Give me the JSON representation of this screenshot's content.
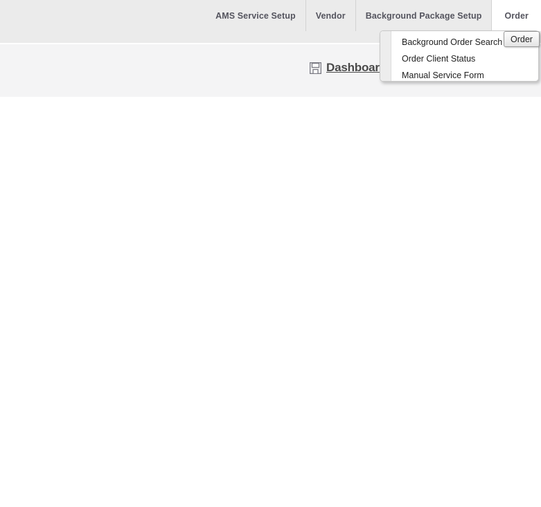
{
  "header": {
    "tabs": [
      {
        "label": "AMS Service Setup",
        "name": "tab-ams-service-setup",
        "active": false
      },
      {
        "label": "Vendor",
        "name": "tab-vendor",
        "active": false
      },
      {
        "label": "Background Package Setup",
        "name": "tab-background-package-setup",
        "active": false
      },
      {
        "label": "Order",
        "name": "tab-order",
        "active": true
      }
    ]
  },
  "sub_header": {
    "dashboard_label": "Dashboard",
    "dashboard_icon": "save-floppy-icon"
  },
  "order_menu": {
    "items": [
      {
        "label": "Background Order Search"
      },
      {
        "label": "Order Client Status"
      },
      {
        "label": "Manual Service Form"
      }
    ]
  },
  "tooltip": {
    "label": "Order"
  },
  "colors": {
    "header_band": "#ebebeb",
    "sub_band": "#f4f4f5",
    "tab_text": "#55555f",
    "active_tab_bg": "#ffffff",
    "menu_bg": "#ffffff",
    "menu_gutter": "#ededed",
    "menu_border": "#c8c8c8",
    "menu_item_text": "#1d1d1d",
    "dashboard_text": "#4a4a4a",
    "content_bg": "#ffffff"
  }
}
